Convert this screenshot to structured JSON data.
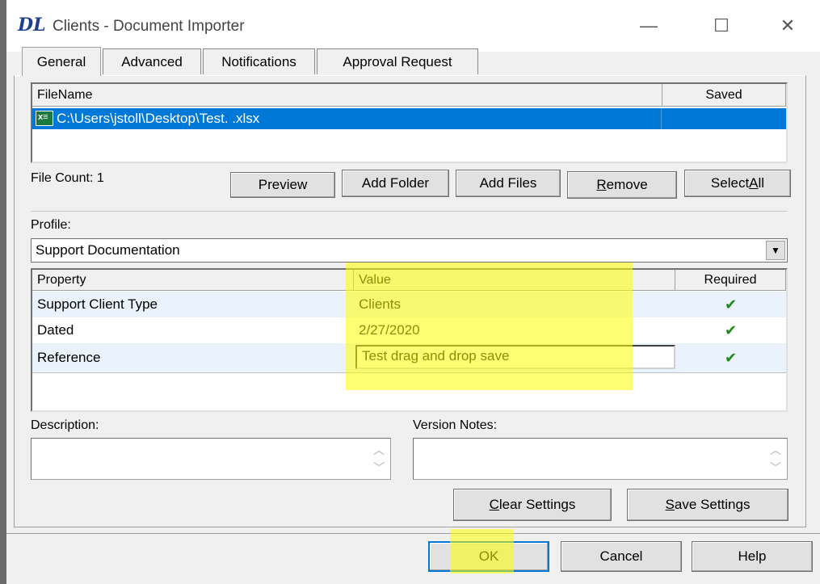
{
  "window": {
    "logo_text": "DL",
    "title": "Clients - Document Importer",
    "minimize_glyph": "—",
    "maximize_glyph": "☐",
    "close_glyph": "✕"
  },
  "tabs": [
    {
      "label": "General",
      "active": true
    },
    {
      "label": "Advanced",
      "active": false
    },
    {
      "label": "Notifications",
      "active": false
    },
    {
      "label": "Approval Request",
      "active": false
    }
  ],
  "file_list": {
    "columns": [
      "FileName",
      "Saved"
    ],
    "rows": [
      {
        "icon": "excel-file-icon",
        "filename": "C:\\Users\\jstoll\\Desktop\\Test. .xlsx",
        "saved": "",
        "selected": true
      }
    ],
    "file_count_label": "File Count: 1"
  },
  "file_buttons": {
    "preview": "Preview",
    "add_folder": "Add Folder",
    "add_files": "Add Files",
    "remove": "Remove",
    "select_all": "Select All"
  },
  "profile": {
    "label": "Profile:",
    "selected": "Support Documentation"
  },
  "properties": {
    "columns": [
      "Property",
      "Value",
      "Required"
    ],
    "rows": [
      {
        "property": "Support Client Type",
        "value": "Clients",
        "required": "✔"
      },
      {
        "property": "Dated",
        "value": "2/27/2020",
        "required": "✔"
      },
      {
        "property": "Reference",
        "value": "Test drag and drop save",
        "required": "✔"
      }
    ]
  },
  "description": {
    "label": "Description:",
    "value": ""
  },
  "version_notes": {
    "label": "Version Notes:",
    "value": ""
  },
  "settings_buttons": {
    "clear": "Clear Settings",
    "save": "Save Settings"
  },
  "dialog_buttons": {
    "ok": "OK",
    "cancel": "Cancel",
    "help": "Help"
  },
  "colors": {
    "selection": "#0078d7",
    "highlight": "#ffff00",
    "check": "#1a8a1a"
  }
}
